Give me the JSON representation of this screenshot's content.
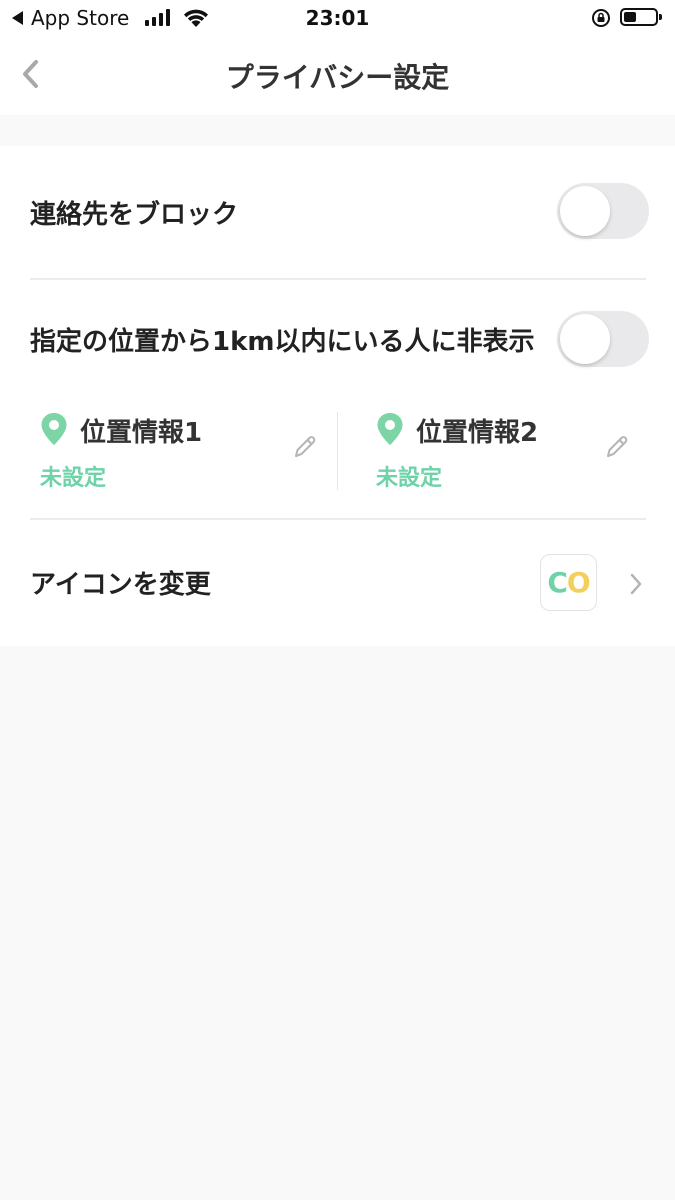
{
  "status_bar": {
    "back_app": "App Store",
    "time": "23:01",
    "battery_level": 0.4
  },
  "nav": {
    "title": "プライバシー設定",
    "back_icon": "chevron-left-icon"
  },
  "settings": {
    "block_contacts": {
      "label": "連絡先をブロック",
      "enabled": false
    },
    "hide_nearby": {
      "label": "指定の位置から1km以内にいる人に非表示",
      "enabled": false
    },
    "locations": [
      {
        "name": "位置情報1",
        "status": "未設定",
        "icon": "map-pin-icon",
        "edit_icon": "pencil-icon"
      },
      {
        "name": "位置情報2",
        "status": "未設定",
        "icon": "map-pin-icon",
        "edit_icon": "pencil-icon"
      }
    ],
    "change_icon": {
      "label": "アイコンを変更",
      "icon_text_c": "C",
      "icon_text_o": "O",
      "chevron_icon": "chevron-right-icon"
    }
  },
  "colors": {
    "accent_green": "#6fd2a8",
    "pin_green": "#7dd4a7",
    "logo_yellow": "#f5cf5b",
    "toggle_off": "#e9e9eb",
    "background": "#f9f9f9"
  }
}
